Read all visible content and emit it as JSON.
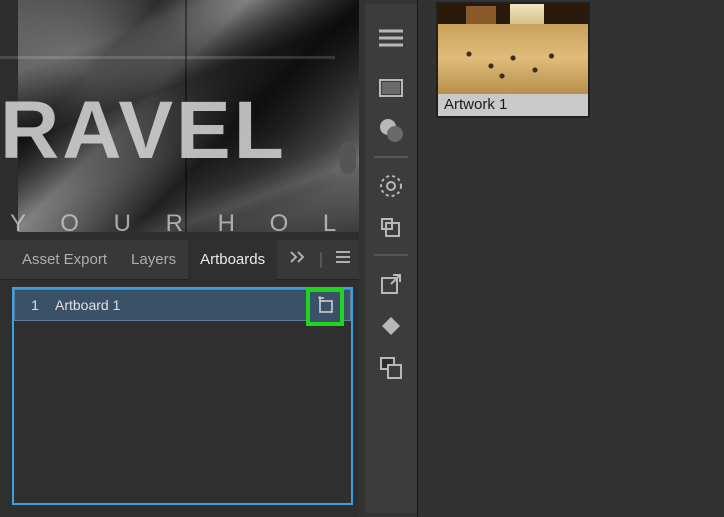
{
  "canvas": {
    "title_text": "RAVEL",
    "subtitle_text": "Y O U R   H O L I D A"
  },
  "panel": {
    "tabs": {
      "asset_export": "Asset Export",
      "layers": "Layers",
      "artboards": "Artboards"
    },
    "artboards_list": [
      {
        "index": "1",
        "name": "Artboard 1"
      }
    ]
  },
  "tool_strip": {
    "icons": [
      "panel-menu-icon",
      "rectangle-gradient-icon",
      "circles-overlap-icon",
      "dotted-circle-icon",
      "crop-small-icon",
      "export-arrow-icon",
      "diamond-layer-icon",
      "overlap-rects-icon"
    ]
  },
  "right_pane": {
    "thumbnail_label": "Artwork 1"
  }
}
